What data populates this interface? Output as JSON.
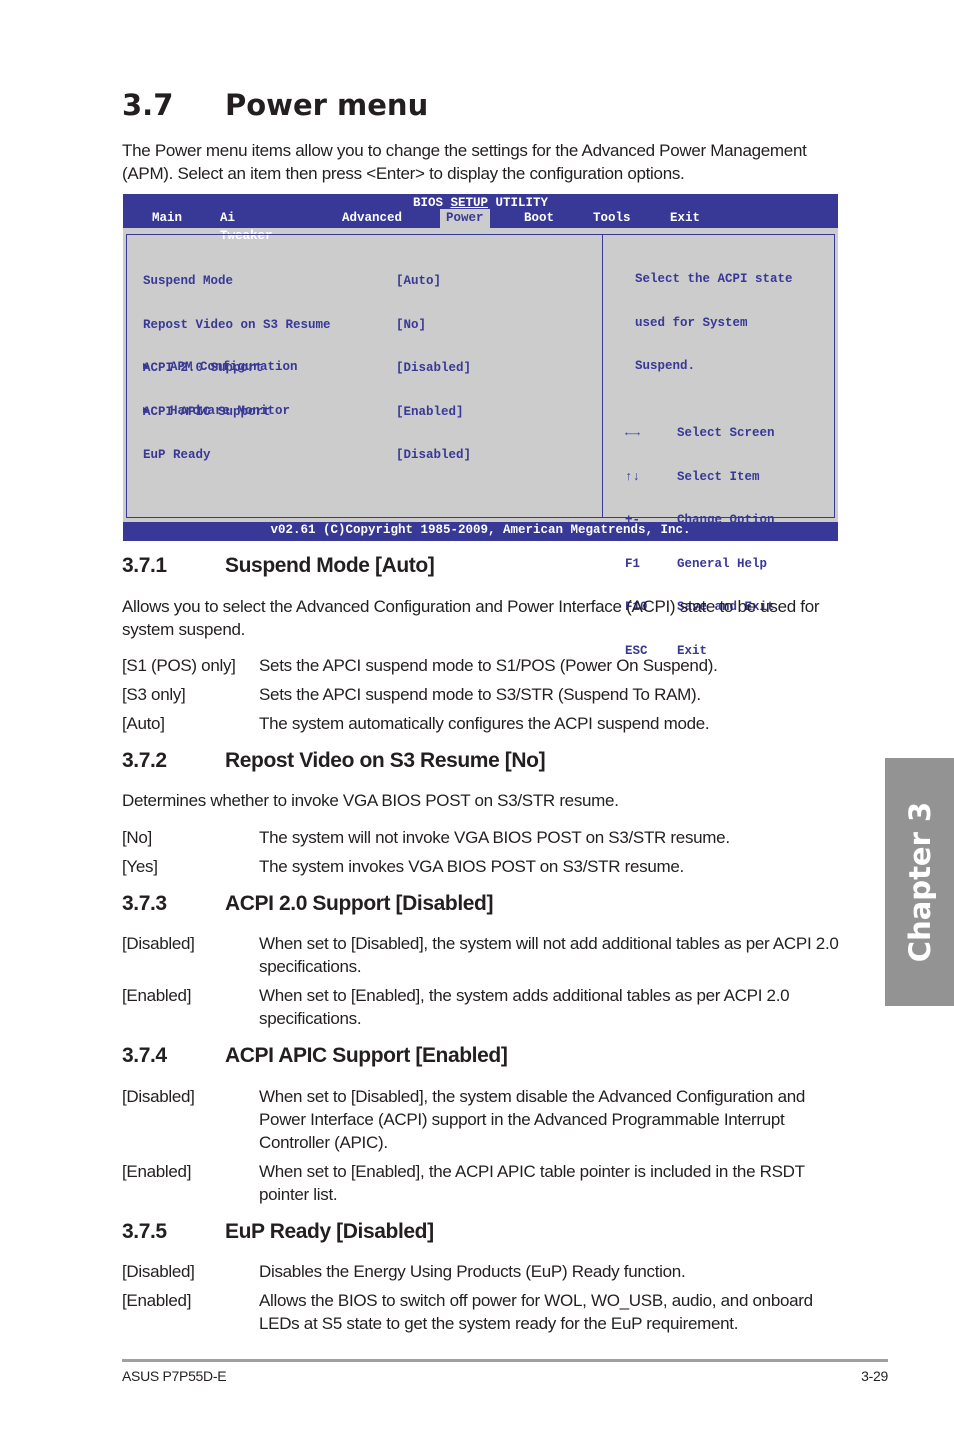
{
  "page": {
    "section_number": "3.7",
    "section_title": "Power menu",
    "intro": "The Power menu items allow you to change the settings for the Advanced Power Management (APM). Select an item then press <Enter> to display the configuration options."
  },
  "bios": {
    "title_left": "BIOS ",
    "title_mid": "SETUP",
    "title_right": " UTILITY",
    "tabs": [
      {
        "label": "Main",
        "active": false
      },
      {
        "label": "Ai Tweaker",
        "active": false
      },
      {
        "label": "Advanced",
        "active": false
      },
      {
        "label": "Power",
        "active": true
      },
      {
        "label": "Boot",
        "active": false
      },
      {
        "label": "Tools",
        "active": false
      },
      {
        "label": "Exit",
        "active": false
      }
    ],
    "items": [
      {
        "label": "Suspend Mode",
        "value": "[Auto]"
      },
      {
        "label": "Repost Video on S3 Resume",
        "value": "[No]"
      },
      {
        "label": "ACPI 2.0 Support",
        "value": "[Disabled]"
      },
      {
        "label": "ACPI APIC Support",
        "value": "[Enabled]"
      },
      {
        "label": "EuP Ready",
        "value": "[Disabled]"
      }
    ],
    "submenus": [
      {
        "label": "APM Configuration"
      },
      {
        "label": "Hardware Monitor"
      }
    ],
    "help_lines": [
      "Select the ACPI state",
      "used for System",
      "Suspend."
    ],
    "keys": [
      {
        "key": "←→",
        "desc": "Select Screen"
      },
      {
        "key": "↑↓",
        "desc": "Select Item"
      },
      {
        "key": "+-",
        "desc": "Change Option"
      },
      {
        "key": "F1",
        "desc": "General Help"
      },
      {
        "key": "F10",
        "desc": "Save and Exit"
      },
      {
        "key": "ESC",
        "desc": "Exit"
      }
    ],
    "copyright": "v02.61 (C)Copyright 1985-2009, American Megatrends, Inc.",
    "colors": {
      "bar": "#383896",
      "panel": "#cccccc",
      "text": "#383896"
    }
  },
  "sections": [
    {
      "number": "3.7.1",
      "title": "Suspend Mode [Auto]",
      "description": "Allows you to select the Advanced Configuration and Power Interface (ACPI) state to be used for system suspend.",
      "options": [
        {
          "option": "[S1 (POS) only]",
          "desc": "Sets the APCI suspend mode to S1/POS (Power On Suspend)."
        },
        {
          "option": "[S3 only]",
          "desc": "Sets the APCI suspend mode to S3/STR (Suspend To RAM)."
        },
        {
          "option": "[Auto]",
          "desc": "The system automatically configures the ACPI suspend mode."
        }
      ]
    },
    {
      "number": "3.7.2",
      "title": "Repost Video on S3 Resume [No]",
      "description": "Determines whether to invoke VGA BIOS POST on S3/STR resume.",
      "options": [
        {
          "option": "[No]",
          "desc": "The system will not invoke VGA BIOS POST on S3/STR resume."
        },
        {
          "option": "[Yes]",
          "desc": "The system invokes VGA BIOS POST on S3/STR resume."
        }
      ]
    },
    {
      "number": "3.7.3",
      "title": "ACPI 2.0 Support [Disabled]",
      "options": [
        {
          "option": "[Disabled]",
          "desc": "When set to [Disabled], the system will not add additional tables as per ACPI 2.0 specifications."
        },
        {
          "option": "[Enabled]",
          "desc": "When set to [Enabled], the system adds additional tables as per ACPI 2.0 specifications."
        }
      ]
    },
    {
      "number": "3.7.4",
      "title": "ACPI APIC Support [Enabled]",
      "options": [
        {
          "option": "[Disabled]",
          "desc": "When set to [Disabled], the system disable the Advanced Configuration and Power Interface (ACPI) support in the Advanced Programmable Interrupt Controller (APIC)."
        },
        {
          "option": "[Enabled]",
          "desc": "When set to [Enabled], the ACPI APIC table pointer is included in the RSDT pointer list."
        }
      ]
    },
    {
      "number": "3.7.5",
      "title": "EuP Ready [Disabled]",
      "options": [
        {
          "option": "[Disabled]",
          "desc": "Disables the Energy Using Products (EuP) Ready function."
        },
        {
          "option": "[Enabled]",
          "desc": "Allows the BIOS to switch off power for WOL, WO_USB, audio, and onboard LEDs at S5 state to get the system ready for the EuP requirement."
        }
      ]
    }
  ],
  "chapter_tab": "Chapter 3",
  "footer": {
    "left": "ASUS P7P55D-E",
    "right": "3-29"
  }
}
